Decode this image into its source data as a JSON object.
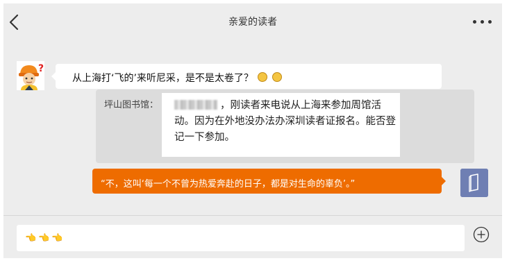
{
  "header": {
    "title": "亲爱的读者"
  },
  "messages": {
    "incoming_text": "从上海打‘飞的’来听尼采，是不是太卷了？",
    "incoming_emojis": [
      "grinning-emoji",
      "grinning-emoji"
    ],
    "quote_sender": "坪山图书馆：",
    "quote_text": "，刚读者来电说从上海来参加周馆活动。因为在外地没办法办深圳读者证报名。能否登记一下参加。",
    "outgoing_text": "“不，这叫‘每一个不曾为热爱奔赴的日子，都是对生命的辜负’。”"
  },
  "composer": {
    "input_value": "👈👈👈"
  },
  "colors": {
    "background": "#ededed",
    "outgoing_bubble": "#ee6c00",
    "quote_box": "#dcdcdc",
    "right_avatar": "#6f7fb3"
  }
}
